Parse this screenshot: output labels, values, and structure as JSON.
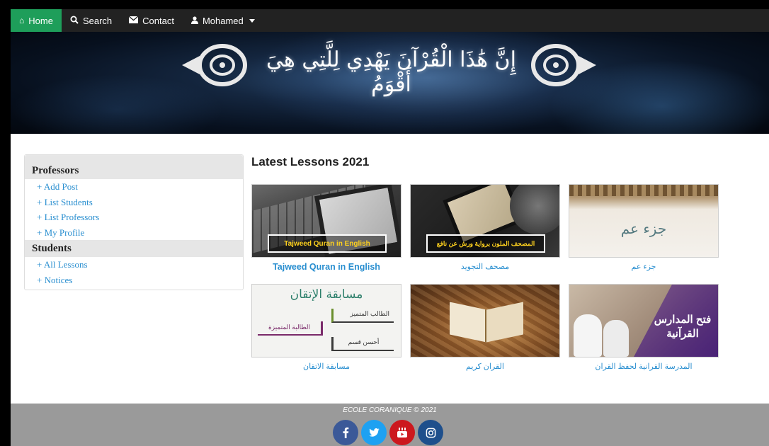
{
  "navbar": {
    "home": "Home",
    "search": "Search",
    "contact": "Contact",
    "user": "Mohamed"
  },
  "banner": {
    "verse": "إِنَّ هَٰذَا الْقُرْآنَ يَهْدِي لِلَّتِي هِيَ أَقْوَمُ"
  },
  "sidebar": {
    "professors_heading": "Professors",
    "professors_links": [
      "+ Add Post",
      "+ List Students",
      "+ List Professors",
      "+ My Profile"
    ],
    "students_heading": "Students",
    "students_links": [
      "+ All Lessons",
      "+ Notices"
    ]
  },
  "main": {
    "title": "Latest Lessons 2021",
    "lessons": [
      {
        "title": "Tajweed Quran in English",
        "overlay": "Tajweed Quran in English"
      },
      {
        "title": "مصحف التجويد",
        "overlay": "المصحف الملون برواية ورش عن نافع"
      },
      {
        "title": "جزء عم",
        "overlay": "جزء عم"
      },
      {
        "title": "مسابقة الاتقان",
        "overlay_title": "مسابقة الإتقان",
        "overlay_items": [
          "الطالب المتميز",
          "الطالبة المتميزة",
          "أحسن قسم"
        ]
      },
      {
        "title": "القران كريم"
      },
      {
        "title": "المدرسة القرانية لحفظ القران",
        "overlay": "فتح المدارس القرآنية"
      }
    ]
  },
  "footer": {
    "text": "ECOLE CORANIQUE © 2021",
    "socials": [
      {
        "icon": "facebook-icon",
        "glyph": "f",
        "color": "#3b5998"
      },
      {
        "icon": "twitter-icon",
        "glyph": "🐦",
        "color": "#1da1f2"
      },
      {
        "icon": "youtube-icon",
        "glyph": "▶",
        "color": "#cc181e"
      },
      {
        "icon": "instagram-icon",
        "glyph": "◎",
        "color": "#1e4f8c"
      }
    ]
  },
  "colors": {
    "nav_active": "#1e9e5a",
    "link": "#2a8fd0",
    "navbar": "#222222",
    "footer": "#9a9a9a"
  }
}
